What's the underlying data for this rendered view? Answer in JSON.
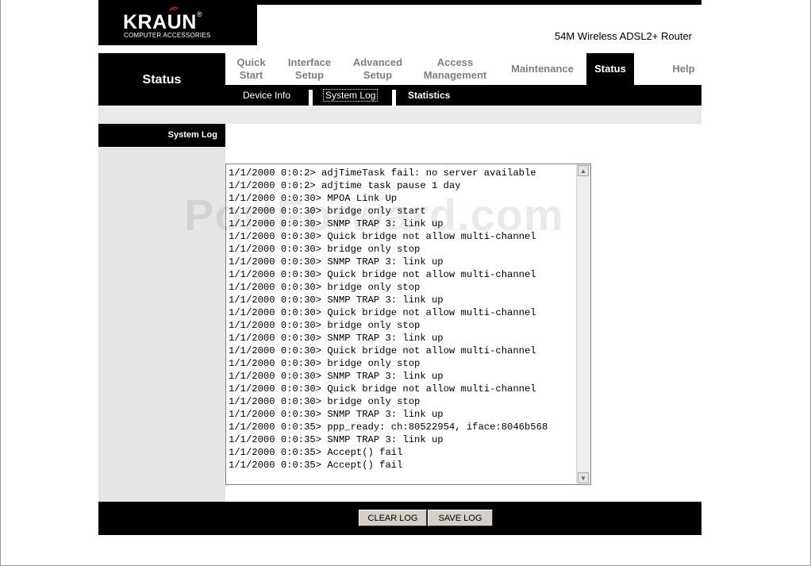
{
  "brand": {
    "logo_text": "KRAUN",
    "logo_registered": "®",
    "logo_subtitle": "COMPUTER ACCESSORIES",
    "product_name": "54M Wireless ADSL2+ Router"
  },
  "section_title": "Status",
  "tabs": [
    {
      "line1": "Quick",
      "line2": "Start"
    },
    {
      "line1": "Interface",
      "line2": "Setup"
    },
    {
      "line1": "Advanced",
      "line2": "Setup"
    },
    {
      "line1": "Access",
      "line2": "Management"
    },
    {
      "line1": "Maintenance",
      "line2": ""
    },
    {
      "line1": "Status",
      "line2": ""
    },
    {
      "line1": "Help",
      "line2": ""
    }
  ],
  "active_tab": "Status",
  "subnav": {
    "device_info": "Device Info",
    "system_log": "System Log",
    "statistics": "Statistics"
  },
  "sidebar_label": "System Log",
  "log_lines": [
    "1/1/2000 0:0:2> adjTimeTask fail: no server available",
    "1/1/2000 0:0:2> adjtime task pause 1 day",
    "1/1/2000 0:0:30> MPOA Link Up",
    "1/1/2000 0:0:30> bridge only start",
    "1/1/2000 0:0:30> SNMP TRAP 3: link up",
    "1/1/2000 0:0:30> Quick bridge not allow multi-channel",
    "1/1/2000 0:0:30> bridge only stop",
    "1/1/2000 0:0:30> SNMP TRAP 3: link up",
    "1/1/2000 0:0:30> Quick bridge not allow multi-channel",
    "1/1/2000 0:0:30> bridge only stop",
    "1/1/2000 0:0:30> SNMP TRAP 3: link up",
    "1/1/2000 0:0:30> Quick bridge not allow multi-channel",
    "1/1/2000 0:0:30> bridge only stop",
    "1/1/2000 0:0:30> SNMP TRAP 3: link up",
    "1/1/2000 0:0:30> Quick bridge not allow multi-channel",
    "1/1/2000 0:0:30> bridge only stop",
    "1/1/2000 0:0:30> SNMP TRAP 3: link up",
    "1/1/2000 0:0:30> Quick bridge not allow multi-channel",
    "1/1/2000 0:0:30> bridge only stop",
    "1/1/2000 0:0:30> SNMP TRAP 3: link up",
    "1/1/2000 0:0:35> ppp_ready: ch:80522954, iface:8046b568",
    "1/1/2000 0:0:35> SNMP TRAP 3: link up",
    "1/1/2000 0:0:35> Accept() fail",
    "1/1/2000 0:0:35> Accept() fail"
  ],
  "buttons": {
    "clear_log": "CLEAR LOG",
    "save_log": "SAVE LOG"
  },
  "watermark": "PortForward.com",
  "colors": {
    "header_bg": "#000000",
    "tab_inactive": "#808080",
    "sidebar_bg": "#e6e6e6",
    "logo_accent": "#cc2222"
  }
}
